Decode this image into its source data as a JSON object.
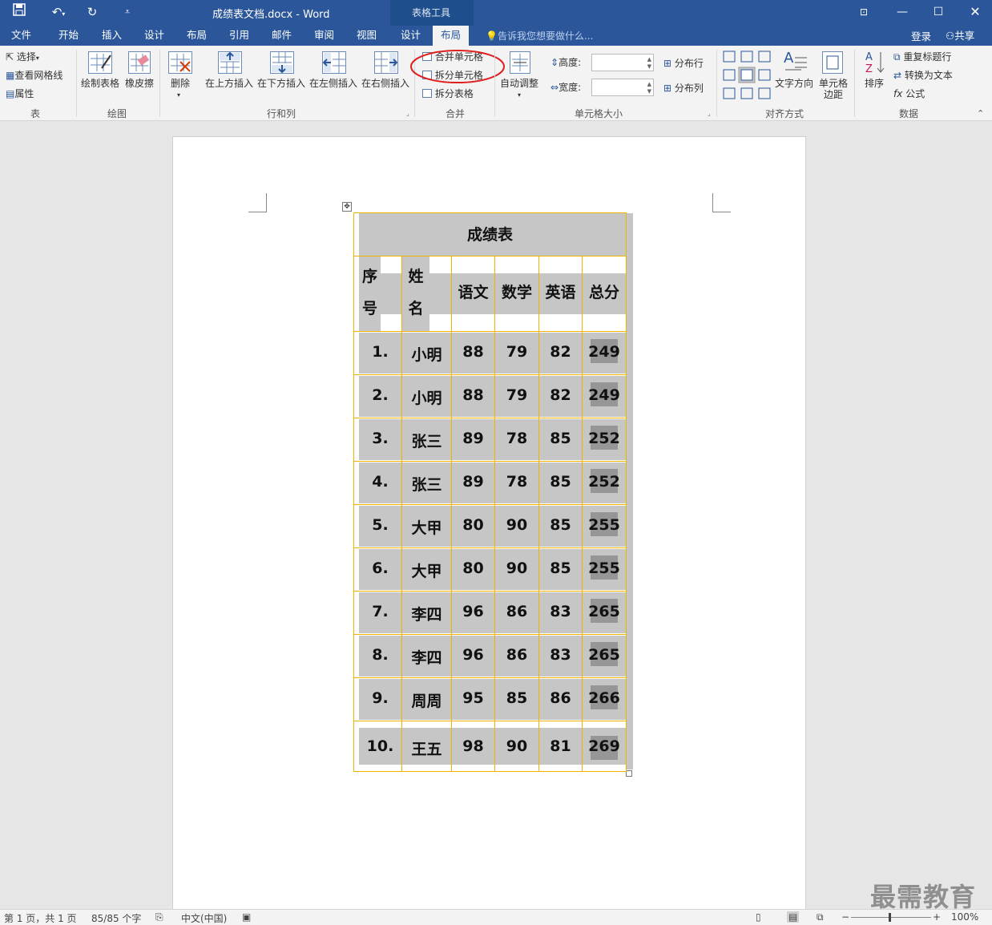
{
  "window": {
    "title": "成绩表文档.docx - Word",
    "context_tab_group": "表格工具"
  },
  "tabs": [
    "文件",
    "开始",
    "插入",
    "设计",
    "布局",
    "引用",
    "邮件",
    "审阅",
    "视图",
    "设计",
    "布局"
  ],
  "active_tab": "布局",
  "tell_me": "告诉我您想要做什么...",
  "account": {
    "login": "登录",
    "share": "共享"
  },
  "ribbon": {
    "table_group": {
      "select": "选择",
      "gridlines": "查看网格线",
      "properties": "属性",
      "label": "表"
    },
    "draw_group": {
      "draw_table": "绘制表格",
      "eraser": "橡皮擦",
      "label": "绘图"
    },
    "rows_cols_group": {
      "delete": "删除",
      "insert_above": "在上方插入",
      "insert_below": "在下方插入",
      "insert_left": "在左侧插入",
      "insert_right": "在右侧插入",
      "label": "行和列"
    },
    "merge_group": {
      "merge_cells": "合并单元格",
      "split_cells": "拆分单元格",
      "split_table": "拆分表格",
      "label": "合并"
    },
    "cell_size_group": {
      "autofit": "自动调整",
      "height_label": "高度:",
      "width_label": "宽度:",
      "height_value": "",
      "width_value": "",
      "distribute_rows": "分布行",
      "distribute_cols": "分布列",
      "label": "单元格大小"
    },
    "align_group": {
      "text_direction": "文字方向",
      "cell_margins": "单元格边距",
      "label": "对齐方式"
    },
    "data_group": {
      "sort": "排序",
      "repeat_header": "重复标题行",
      "convert_to_text": "转换为文本",
      "formula": "公式",
      "label": "数据"
    }
  },
  "table": {
    "title": "成绩表",
    "headers": {
      "seq_top": "序",
      "seq_bottom": "号",
      "name_top": "姓",
      "name_bottom": "名",
      "chinese": "语文",
      "math": "数学",
      "english": "英语",
      "total": "总分"
    },
    "rows": [
      {
        "seq": "1.",
        "name": "小明",
        "chinese": "88",
        "math": "79",
        "english": "82",
        "total": "249"
      },
      {
        "seq": "2.",
        "name": "小明",
        "chinese": "88",
        "math": "79",
        "english": "82",
        "total": "249"
      },
      {
        "seq": "3.",
        "name": "张三",
        "chinese": "89",
        "math": "78",
        "english": "85",
        "total": "252"
      },
      {
        "seq": "4.",
        "name": "张三",
        "chinese": "89",
        "math": "78",
        "english": "85",
        "total": "252"
      },
      {
        "seq": "5.",
        "name": "大甲",
        "chinese": "80",
        "math": "90",
        "english": "85",
        "total": "255"
      },
      {
        "seq": "6.",
        "name": "大甲",
        "chinese": "80",
        "math": "90",
        "english": "85",
        "total": "255"
      },
      {
        "seq": "7.",
        "name": "李四",
        "chinese": "96",
        "math": "86",
        "english": "83",
        "total": "265"
      },
      {
        "seq": "8.",
        "name": "李四",
        "chinese": "96",
        "math": "86",
        "english": "83",
        "total": "265"
      },
      {
        "seq": "9.",
        "name": "周周",
        "chinese": "95",
        "math": "85",
        "english": "86",
        "total": "266"
      },
      {
        "seq": "10.",
        "name": "王五",
        "chinese": "98",
        "math": "90",
        "english": "81",
        "total": "269"
      }
    ]
  },
  "status": {
    "page": "第 1 页，共 1 页",
    "words": "85/85 个字",
    "language": "中文(中国)",
    "zoom": "100%"
  },
  "watermark": "最需教育",
  "colors": {
    "accent": "#2b579a",
    "cell_border": "#f0b400",
    "highlight_circle": "#e02020",
    "cell_shading": "#c6c6c6",
    "total_shading": "#969696"
  }
}
